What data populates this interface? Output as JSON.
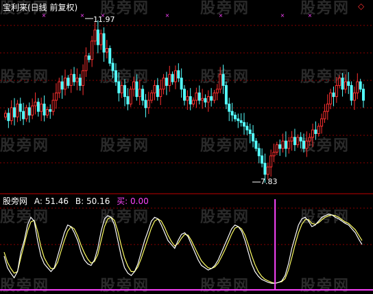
{
  "title": "宝利来(日线 前复权)",
  "watermark": "股旁网",
  "corner_icons": {
    "left": "◇",
    "right": "◇"
  },
  "max_label": "11.97",
  "min_label": "7.83",
  "indicator": {
    "name": "股旁网",
    "a_label": "A: 51.46",
    "b_label": "B: 50.16",
    "buy_label": "买: 0.00"
  },
  "colors": {
    "up": "#ff3030",
    "down": "#54ffff",
    "line_a": "#ffffff",
    "line_b": "#ffff66",
    "buy": "#ff44ff",
    "grid": "#8b0000",
    "background": "#000000"
  },
  "chart_data": {
    "type": "candlestick",
    "price_range": [
      7.6,
      12.2
    ],
    "highest": 11.97,
    "lowest": 7.83,
    "closes": [
      9.55,
      9.35,
      9.7,
      9.45,
      9.8,
      9.6,
      9.4,
      9.7,
      9.5,
      9.75,
      9.85,
      9.6,
      9.8,
      9.5,
      9.65,
      9.6,
      9.9,
      10.1,
      10.4,
      10.2,
      10.5,
      10.3,
      10.6,
      10.4,
      10.5,
      10.3,
      10.7,
      11.1,
      11.0,
      11.5,
      11.8,
      11.4,
      11.7,
      11.2,
      11.3,
      10.9,
      10.7,
      10.4,
      10.1,
      10.3,
      10.0,
      9.8,
      10.2,
      10.4,
      10.0,
      10.2,
      9.9,
      9.7,
      9.9,
      10.1,
      10.3,
      10.0,
      10.2,
      10.5,
      10.3,
      10.6,
      10.4,
      10.7,
      10.5,
      10.2,
      9.9,
      10.0,
      9.8,
      9.9,
      10.1,
      9.9,
      9.95,
      9.85,
      10.0,
      9.9,
      10.1,
      10.2,
      10.6,
      10.3,
      9.8,
      9.6,
      9.5,
      9.4,
      9.35,
      9.3,
      9.2,
      9.1,
      9.0,
      8.8,
      8.6,
      8.4,
      8.2,
      7.9,
      8.1,
      8.4,
      8.5,
      8.7,
      8.6,
      8.8,
      8.6,
      8.8,
      8.9,
      8.7,
      8.9,
      8.8,
      8.6,
      8.8,
      8.9,
      9.1,
      9.0,
      9.2,
      9.4,
      9.6,
      9.8,
      10.1,
      10.0,
      10.3,
      10.5,
      10.2,
      10.4,
      10.3,
      9.9,
      10.1,
      10.4,
      10.2,
      9.9
    ],
    "indicator_a": [
      40,
      25,
      18,
      12,
      20,
      45,
      60,
      80,
      90,
      85,
      60,
      40,
      30,
      25,
      20,
      25,
      40,
      55,
      70,
      80,
      78,
      70,
      60,
      45,
      35,
      30,
      28,
      35,
      50,
      72,
      88,
      92,
      90,
      80,
      60,
      40,
      25,
      18,
      15,
      20,
      30,
      45,
      60,
      72,
      85,
      90,
      88,
      80,
      70,
      60,
      55,
      50,
      60,
      68,
      70,
      65,
      55,
      45,
      35,
      28,
      25,
      22,
      24,
      28,
      35,
      45,
      55,
      65,
      75,
      80,
      78,
      72,
      60,
      45,
      30,
      20,
      14,
      10,
      8,
      6,
      5,
      5,
      6,
      8,
      15,
      30,
      50,
      65,
      80,
      88,
      90,
      85,
      78,
      80,
      85,
      90,
      92,
      94,
      93,
      90,
      88,
      85,
      82,
      80,
      75,
      70,
      62,
      55
    ],
    "indicator_b": [
      45,
      32,
      24,
      18,
      20,
      38,
      55,
      72,
      84,
      86,
      72,
      52,
      38,
      30,
      24,
      24,
      32,
      46,
      60,
      72,
      78,
      75,
      66,
      54,
      44,
      36,
      31,
      33,
      42,
      60,
      78,
      88,
      90,
      86,
      72,
      54,
      38,
      27,
      20,
      20,
      26,
      37,
      50,
      63,
      76,
      85,
      88,
      85,
      77,
      67,
      59,
      53,
      56,
      63,
      68,
      67,
      60,
      51,
      42,
      34,
      29,
      25,
      24,
      26,
      31,
      39,
      48,
      58,
      68,
      76,
      78,
      75,
      67,
      55,
      41,
      29,
      20,
      14,
      10,
      8,
      6,
      5,
      6,
      7,
      11,
      22,
      38,
      55,
      70,
      81,
      87,
      87,
      82,
      81,
      83,
      87,
      90,
      92,
      93,
      92,
      90,
      87,
      84,
      82,
      78,
      74,
      67,
      60
    ],
    "buy_spike_index": 81
  }
}
